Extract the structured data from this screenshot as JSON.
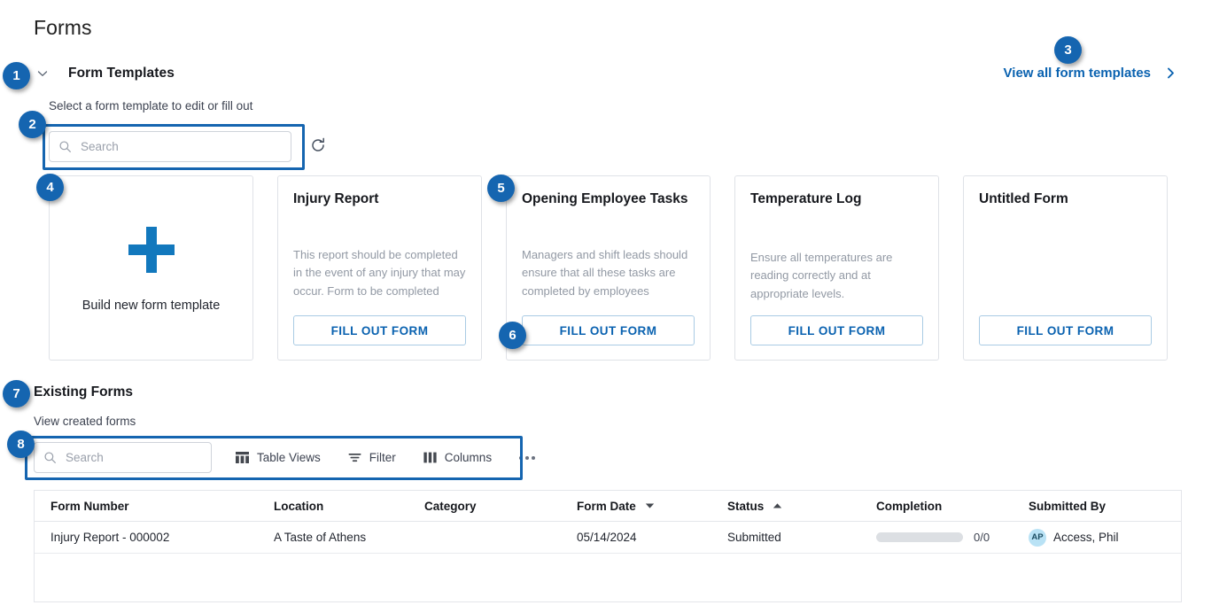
{
  "page": {
    "title": "Forms"
  },
  "form_templates": {
    "section_title": "Form Templates",
    "subtitle": "Select a form template to edit or fill out",
    "view_all_label": "View all form templates",
    "search_placeholder": "Search",
    "search_value": "",
    "refresh_icon": "refresh-icon",
    "chevron_icon": "chevron-down-icon",
    "new_template": {
      "label": "Build new form template",
      "icon": "plus-icon"
    },
    "cards": [
      {
        "title": "Injury Report",
        "description": "This report should be completed in the event of any injury that may occur. Form to be completed by…",
        "button_label": "FILL OUT FORM"
      },
      {
        "title": "Opening Employee Tasks",
        "description": "Managers and shift leads should ensure that all these tasks are completed by employees before…",
        "button_label": "FILL OUT FORM"
      },
      {
        "title": "Temperature Log",
        "description": "Ensure all temperatures are reading correctly and at appropriate levels.",
        "button_label": "FILL OUT FORM"
      },
      {
        "title": "Untitled Form",
        "description": "",
        "button_label": "FILL OUT FORM"
      }
    ]
  },
  "existing_forms": {
    "section_title": "Existing Forms",
    "subtitle": "View created forms",
    "search_placeholder": "Search",
    "search_value": "",
    "toolbar": [
      {
        "label": "Table Views",
        "icon": "table-views-icon"
      },
      {
        "label": "Filter",
        "icon": "filter-icon"
      },
      {
        "label": "Columns",
        "icon": "columns-icon"
      }
    ],
    "more_label": "•••",
    "table": {
      "columns": [
        {
          "label": "Form Number",
          "sort": "none"
        },
        {
          "label": "Location",
          "sort": "none"
        },
        {
          "label": "Category",
          "sort": "none"
        },
        {
          "label": "Form Date",
          "sort": "desc"
        },
        {
          "label": "Status",
          "sort": "asc"
        },
        {
          "label": "Completion",
          "sort": "none"
        },
        {
          "label": "Submitted By",
          "sort": "none"
        }
      ],
      "rows": [
        {
          "form_number": "Injury Report - 000002",
          "location": "A Taste of Athens",
          "category": "",
          "form_date": "05/14/2024",
          "status": "Submitted",
          "completion_count": "0/0",
          "completion_percent": 0,
          "submitted_by": "Access, Phil",
          "submitted_by_initials": "AP"
        }
      ]
    }
  },
  "annotations": {
    "badges": [
      "1",
      "2",
      "3",
      "4",
      "5",
      "6",
      "7",
      "8"
    ],
    "accent_color": "#1565b0"
  },
  "colors": {
    "accent": "#1565b0",
    "link": "#0a62b0",
    "plus": "#1278bd",
    "card_border": "#dfe2e7",
    "muted_text": "#9299a4",
    "avatar_bg": "#b9e2f5"
  }
}
